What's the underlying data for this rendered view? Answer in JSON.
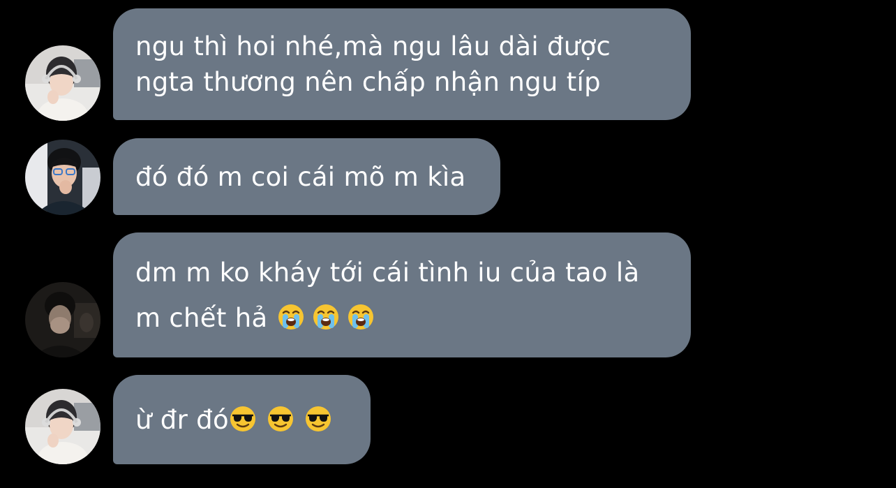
{
  "colors": {
    "background": "#000000",
    "bubble": "#6b7785",
    "text": "#ffffff"
  },
  "messages": [
    {
      "avatar": "avatar-boy-headphones",
      "lines": [
        "ngu thì hoi nhé,mà ngu lâu dài được",
        "ngta thương nên chấp nhận ngu típ"
      ]
    },
    {
      "avatar": "avatar-boy-glasses",
      "lines": [
        "đó đó m coi cái mõ m kìa"
      ]
    },
    {
      "avatar": "avatar-boy-dark",
      "lines": [
        "dm m ko kháy tới cái tình iu của tao là",
        "m chết hả"
      ],
      "emojis": [
        "crying-face-icon",
        "crying-face-icon",
        "crying-face-icon"
      ]
    },
    {
      "avatar": "avatar-boy-headphones",
      "lines": [
        "ừ đr đó"
      ],
      "emojis": [
        "sunglasses-face-icon",
        "sunglasses-face-icon",
        "sunglasses-face-icon"
      ]
    }
  ]
}
